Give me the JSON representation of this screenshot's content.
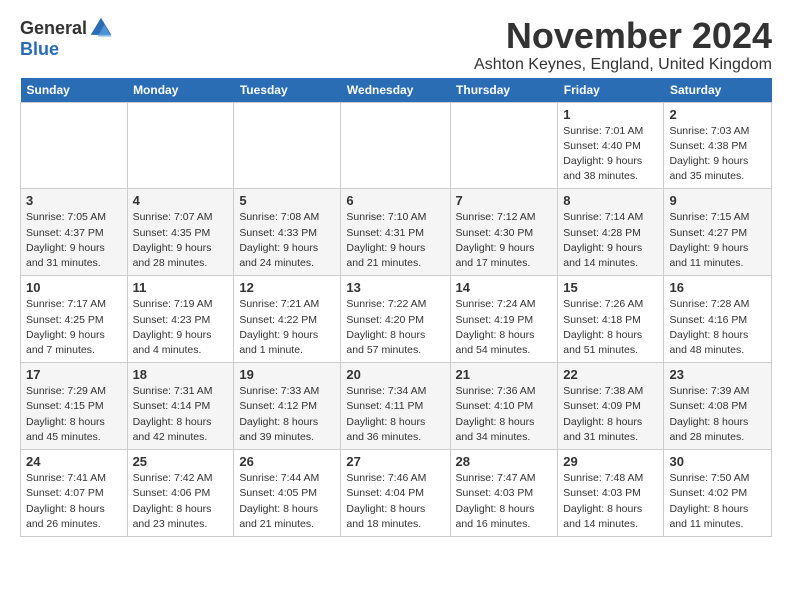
{
  "logo": {
    "general": "General",
    "blue": "Blue"
  },
  "title": "November 2024",
  "location": "Ashton Keynes, England, United Kingdom",
  "days_of_week": [
    "Sunday",
    "Monday",
    "Tuesday",
    "Wednesday",
    "Thursday",
    "Friday",
    "Saturday"
  ],
  "weeks": [
    [
      {
        "day": "",
        "info": ""
      },
      {
        "day": "",
        "info": ""
      },
      {
        "day": "",
        "info": ""
      },
      {
        "day": "",
        "info": ""
      },
      {
        "day": "",
        "info": ""
      },
      {
        "day": "1",
        "info": "Sunrise: 7:01 AM\nSunset: 4:40 PM\nDaylight: 9 hours\nand 38 minutes."
      },
      {
        "day": "2",
        "info": "Sunrise: 7:03 AM\nSunset: 4:38 PM\nDaylight: 9 hours\nand 35 minutes."
      }
    ],
    [
      {
        "day": "3",
        "info": "Sunrise: 7:05 AM\nSunset: 4:37 PM\nDaylight: 9 hours\nand 31 minutes."
      },
      {
        "day": "4",
        "info": "Sunrise: 7:07 AM\nSunset: 4:35 PM\nDaylight: 9 hours\nand 28 minutes."
      },
      {
        "day": "5",
        "info": "Sunrise: 7:08 AM\nSunset: 4:33 PM\nDaylight: 9 hours\nand 24 minutes."
      },
      {
        "day": "6",
        "info": "Sunrise: 7:10 AM\nSunset: 4:31 PM\nDaylight: 9 hours\nand 21 minutes."
      },
      {
        "day": "7",
        "info": "Sunrise: 7:12 AM\nSunset: 4:30 PM\nDaylight: 9 hours\nand 17 minutes."
      },
      {
        "day": "8",
        "info": "Sunrise: 7:14 AM\nSunset: 4:28 PM\nDaylight: 9 hours\nand 14 minutes."
      },
      {
        "day": "9",
        "info": "Sunrise: 7:15 AM\nSunset: 4:27 PM\nDaylight: 9 hours\nand 11 minutes."
      }
    ],
    [
      {
        "day": "10",
        "info": "Sunrise: 7:17 AM\nSunset: 4:25 PM\nDaylight: 9 hours\nand 7 minutes."
      },
      {
        "day": "11",
        "info": "Sunrise: 7:19 AM\nSunset: 4:23 PM\nDaylight: 9 hours\nand 4 minutes."
      },
      {
        "day": "12",
        "info": "Sunrise: 7:21 AM\nSunset: 4:22 PM\nDaylight: 9 hours\nand 1 minute."
      },
      {
        "day": "13",
        "info": "Sunrise: 7:22 AM\nSunset: 4:20 PM\nDaylight: 8 hours\nand 57 minutes."
      },
      {
        "day": "14",
        "info": "Sunrise: 7:24 AM\nSunset: 4:19 PM\nDaylight: 8 hours\nand 54 minutes."
      },
      {
        "day": "15",
        "info": "Sunrise: 7:26 AM\nSunset: 4:18 PM\nDaylight: 8 hours\nand 51 minutes."
      },
      {
        "day": "16",
        "info": "Sunrise: 7:28 AM\nSunset: 4:16 PM\nDaylight: 8 hours\nand 48 minutes."
      }
    ],
    [
      {
        "day": "17",
        "info": "Sunrise: 7:29 AM\nSunset: 4:15 PM\nDaylight: 8 hours\nand 45 minutes."
      },
      {
        "day": "18",
        "info": "Sunrise: 7:31 AM\nSunset: 4:14 PM\nDaylight: 8 hours\nand 42 minutes."
      },
      {
        "day": "19",
        "info": "Sunrise: 7:33 AM\nSunset: 4:12 PM\nDaylight: 8 hours\nand 39 minutes."
      },
      {
        "day": "20",
        "info": "Sunrise: 7:34 AM\nSunset: 4:11 PM\nDaylight: 8 hours\nand 36 minutes."
      },
      {
        "day": "21",
        "info": "Sunrise: 7:36 AM\nSunset: 4:10 PM\nDaylight: 8 hours\nand 34 minutes."
      },
      {
        "day": "22",
        "info": "Sunrise: 7:38 AM\nSunset: 4:09 PM\nDaylight: 8 hours\nand 31 minutes."
      },
      {
        "day": "23",
        "info": "Sunrise: 7:39 AM\nSunset: 4:08 PM\nDaylight: 8 hours\nand 28 minutes."
      }
    ],
    [
      {
        "day": "24",
        "info": "Sunrise: 7:41 AM\nSunset: 4:07 PM\nDaylight: 8 hours\nand 26 minutes."
      },
      {
        "day": "25",
        "info": "Sunrise: 7:42 AM\nSunset: 4:06 PM\nDaylight: 8 hours\nand 23 minutes."
      },
      {
        "day": "26",
        "info": "Sunrise: 7:44 AM\nSunset: 4:05 PM\nDaylight: 8 hours\nand 21 minutes."
      },
      {
        "day": "27",
        "info": "Sunrise: 7:46 AM\nSunset: 4:04 PM\nDaylight: 8 hours\nand 18 minutes."
      },
      {
        "day": "28",
        "info": "Sunrise: 7:47 AM\nSunset: 4:03 PM\nDaylight: 8 hours\nand 16 minutes."
      },
      {
        "day": "29",
        "info": "Sunrise: 7:48 AM\nSunset: 4:03 PM\nDaylight: 8 hours\nand 14 minutes."
      },
      {
        "day": "30",
        "info": "Sunrise: 7:50 AM\nSunset: 4:02 PM\nDaylight: 8 hours\nand 11 minutes."
      }
    ]
  ]
}
